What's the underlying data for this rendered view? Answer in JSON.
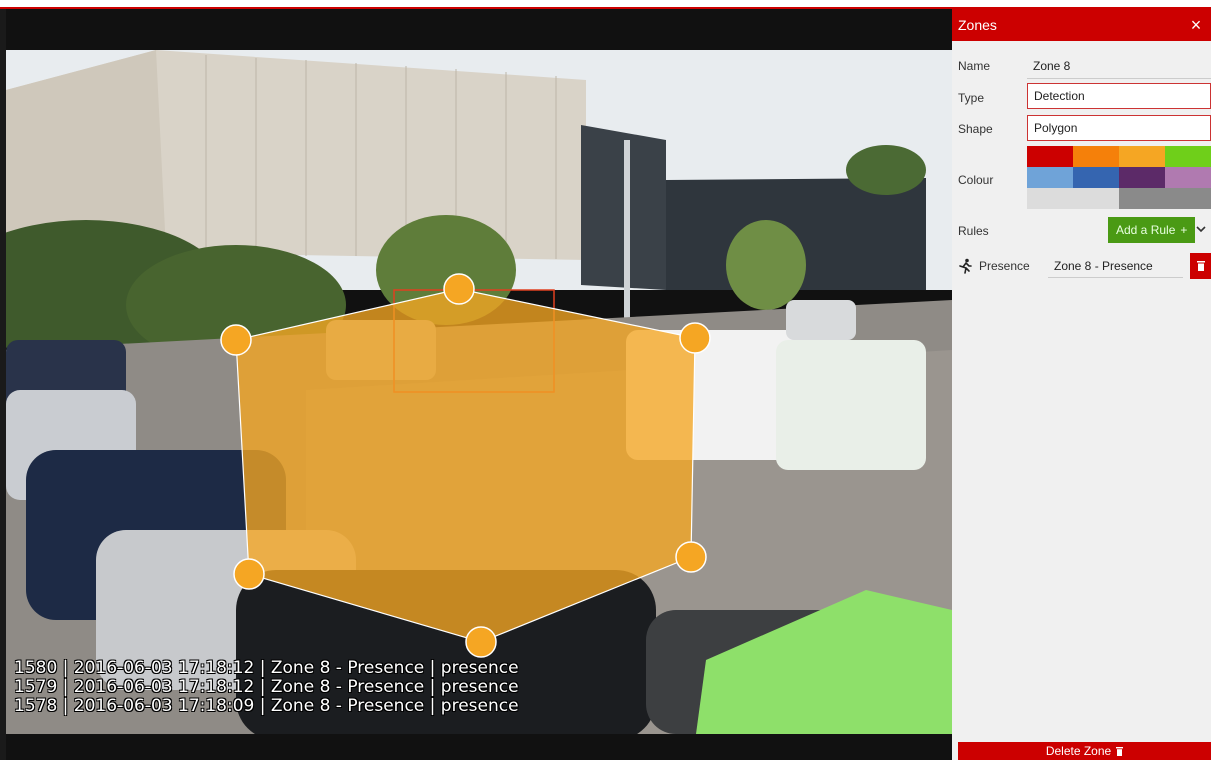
{
  "video": {
    "log_lines": [
      "1580 | 2016-06-03 17:18:12 | Zone 8 - Presence | presence",
      "1579 | 2016-06-03 17:18:12 | Zone 8 - Presence | presence",
      "1578 | 2016-06-03 17:18:09 | Zone 8 - Presence | presence"
    ],
    "zone_color": "#f5a623"
  },
  "panel": {
    "title": "Zones",
    "close_icon": "close-icon",
    "name_label": "Name",
    "name_value": "Zone 8",
    "type_label": "Type",
    "type_value": "Detection",
    "shape_label": "Shape",
    "shape_value": "Polygon",
    "colour_label": "Colour",
    "colours": [
      "#cc0000",
      "#f5800a",
      "#f5a623",
      "#6fcf1a",
      "#6fa3d8",
      "#3565b0",
      "#5c2a68",
      "#b07ab0",
      "#dcdcdc",
      "#dcdcdc",
      "#8a8a8a",
      "#8a8a8a"
    ],
    "rules_label": "Rules",
    "add_rule_label": "Add a Rule",
    "add_rule_icon": "+",
    "rules": [
      {
        "icon": "run-icon",
        "type": "Presence",
        "name": "Zone 8 - Presence"
      }
    ],
    "delete_label": "Delete Zone",
    "delete_icon": "trash-icon"
  }
}
